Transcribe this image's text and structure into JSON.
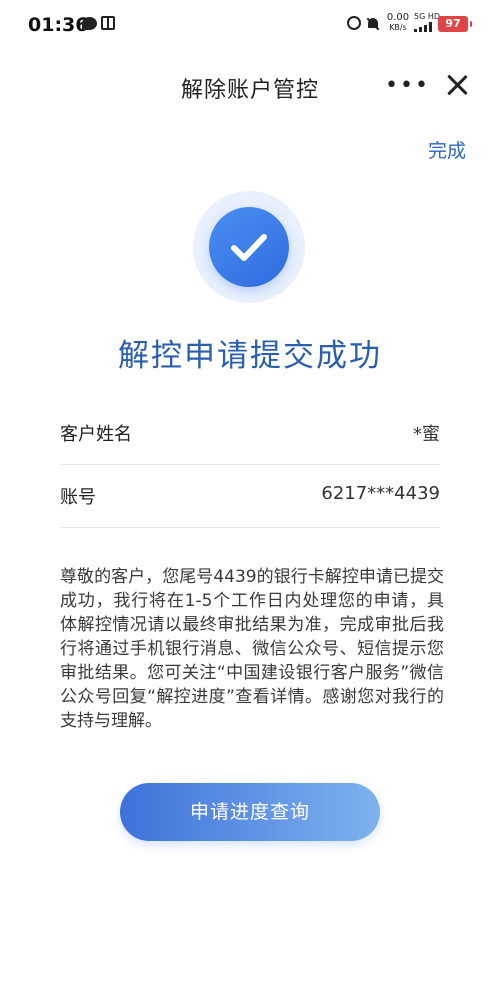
{
  "status_bar": {
    "time": "01:36",
    "net_speed_value": "0.00",
    "net_speed_unit": "KB/s",
    "network_type": "5G HD",
    "battery": "97"
  },
  "nav": {
    "title": "解除账户管控",
    "more_label": "•••"
  },
  "actions": {
    "done_label": "完成"
  },
  "result": {
    "title": "解控申请提交成功"
  },
  "info": [
    {
      "label": "客户姓名",
      "value": "*蜜"
    },
    {
      "label": "账号",
      "value": "6217***4439"
    }
  ],
  "description": "尊敬的客户，您尾号4439的银行卡解控申请已提交成功，我行将在1-5个工作日内处理您的申请，具体解控情况请以最终审批结果为准，完成审批后我行将通过手机银行消息、微信公众号、短信提示您审批结果。您可关注“中国建设银行客户服务”微信公众号回复“解控进度”查看详情。感谢您对我行的支持与理解。",
  "buttons": {
    "query_label": "申请进度查询"
  },
  "colors": {
    "accent": "#2f6be0",
    "title": "#2a5fad",
    "battery": "#e04545"
  }
}
